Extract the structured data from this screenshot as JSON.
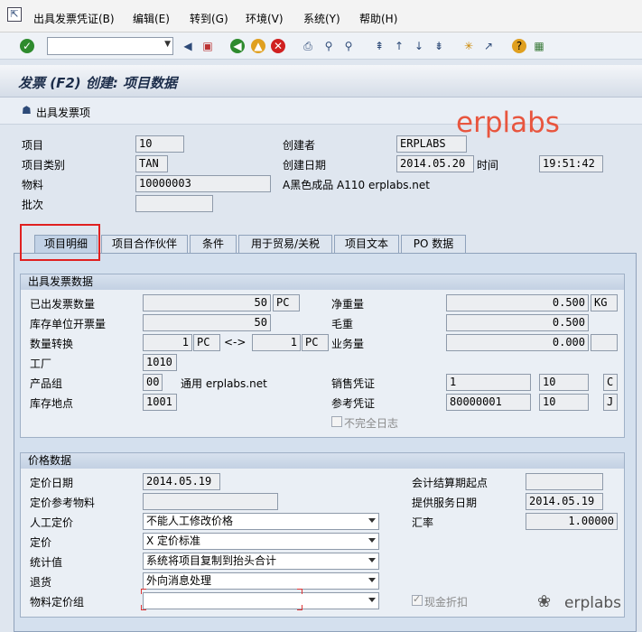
{
  "menu": {
    "items": [
      "出具发票凭证(B)",
      "编辑(E)",
      "转到(G)",
      "环境(V)",
      "系统(Y)",
      "帮助(H)"
    ]
  },
  "title": "发票 (F2) 创建: 项目数据",
  "appbar": {
    "button_label": "出具发票项"
  },
  "watermark": "erplabs",
  "header": {
    "item_label": "项目",
    "item_value": "10",
    "item_cat_label": "项目类别",
    "item_cat_value": "TAN",
    "material_label": "物料",
    "material_value": "10000003",
    "material_desc": "A黑色成品 A110 erplabs.net",
    "batch_label": "批次",
    "batch_value": "",
    "created_by_label": "创建者",
    "created_by_value": "ERPLABS",
    "created_on_label": "创建日期",
    "created_on_value": "2014.05.20",
    "time_label": "时间",
    "time_value": "19:51:42"
  },
  "tabs": [
    "项目明细",
    "项目合作伙伴",
    "条件",
    "用于贸易/关税",
    "项目文本",
    "PO 数据"
  ],
  "billing": {
    "title": "出具发票数据",
    "billed_qty_label": "已出发票数量",
    "billed_qty": "50",
    "billed_qty_unit": "PC",
    "stock_qty_label": "库存单位开票量",
    "stock_qty": "50",
    "conv_label": "数量转换",
    "conv_left": "1",
    "conv_left_unit": "PC",
    "conv_arrow": "<->",
    "conv_right": "1",
    "conv_right_unit": "PC",
    "plant_label": "工厂",
    "plant": "1010",
    "prod_group_label": "产品组",
    "prod_group": "00",
    "prod_group_desc": "通用 erplabs.net",
    "storage_label": "库存地点",
    "storage": "1001",
    "net_weight_label": "净重量",
    "net_weight": "0.500",
    "weight_unit": "KG",
    "gross_weight_label": "毛重",
    "gross_weight": "0.500",
    "volume_label": "业务量",
    "volume": "0.000",
    "volume_unit": "",
    "sales_doc_label": "销售凭证",
    "sales_doc": "1",
    "sales_item": "10",
    "sales_cat": "C",
    "ref_doc_label": "参考凭证",
    "ref_doc": "80000001",
    "ref_item": "10",
    "ref_cat": "J",
    "incomplete_label": "不完全日志"
  },
  "pricing": {
    "title": "价格数据",
    "price_date_label": "定价日期",
    "price_date": "2014.05.19",
    "price_ref_mat_label": "定价参考物料",
    "price_ref_mat": "",
    "manual_label": "人工定价",
    "manual": "不能人工修改价格",
    "pricing_label": "定价",
    "pricing": "X 定价标准",
    "stat_label": "统计值",
    "stat": "系统将项目复制到抬头合计",
    "returns_label": "退货",
    "returns": "外向消息处理",
    "mat_price_grp_label": "物料定价组",
    "mat_price_grp": "",
    "settle_start_label": "会计结算期起点",
    "settle_start": "",
    "service_date_label": "提供服务日期",
    "service_date": "2014.05.19",
    "exch_rate_label": "汇率",
    "exch_rate": "1.00000",
    "cash_disc_label": "现金折扣"
  },
  "footer_brand": "erplabs"
}
